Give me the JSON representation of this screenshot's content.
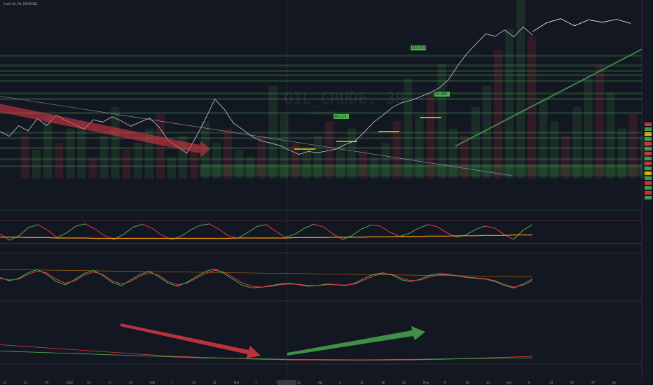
{
  "header": {
    "symbol_line": "Crude Oil, 30, [WTI/USD]"
  },
  "watermark": {
    "symbol": "OIL_CRUDE, 30",
    "name": "Crude Oil"
  },
  "colors": {
    "bg": "#131722",
    "bull": "#26a69a",
    "green": "#4caf50",
    "red": "#e53945",
    "orange": "#ff9800",
    "axis": "#787b86"
  },
  "price_labels": [
    {
      "text": "110.000",
      "value": 110.0
    },
    {
      "text": "99.485",
      "value": 99.485
    },
    {
      "text": "89.113",
      "value": 89.113
    }
  ],
  "time_axis": {
    "labels": [
      "15",
      "22",
      "29",
      "2022",
      "10",
      "17",
      "24",
      "Feb",
      "7",
      "14",
      "21",
      "Mar",
      "7",
      "14",
      "21",
      "Apr",
      "4",
      "11",
      "18",
      "25",
      "May",
      "9",
      "16",
      "23",
      "Jun",
      "6",
      "13",
      "20",
      "27",
      "Jul"
    ],
    "cursor_label": ""
  },
  "chart_data": [
    {
      "type": "line",
      "title": "",
      "series": [
        {
          "values": [
            84.0,
            83.2,
            85.0,
            84.1,
            86.2,
            85.0,
            86.8,
            85.9,
            85.2,
            84.4,
            86.0,
            85.6,
            86.5,
            85.8,
            84.9,
            85.6,
            86.3,
            84.8,
            82.5,
            81.4,
            80.3,
            83.1,
            86.2,
            89.5,
            87.8,
            85.4,
            84.3,
            83.1,
            82.4,
            82.0,
            81.6,
            80.8,
            80.1,
            80.6,
            80.4,
            80.7,
            81.0,
            81.8,
            82.4,
            83.9,
            85.6,
            86.8,
            88.1,
            88.9,
            89.3,
            89.9,
            90.6,
            91.4,
            92.8,
            95.2,
            97.3,
            99.0,
            100.6,
            100.2,
            101.3,
            100.1,
            101.8,
            100.4
          ]
        }
      ],
      "signal_levels": [
        81.0,
        82.3,
        84.0,
        86.4
      ],
      "volume_bars": [
        6,
        4,
        9,
        5,
        7,
        8,
        3,
        6,
        10,
        4,
        5,
        7,
        9,
        3,
        6,
        4,
        8,
        5,
        7,
        4,
        3,
        6,
        13,
        9,
        5,
        4,
        6,
        8,
        5,
        7,
        4,
        3,
        5,
        8,
        14,
        9,
        12,
        16,
        7,
        6,
        10,
        13,
        18,
        21,
        25,
        20,
        11,
        8,
        6,
        10,
        14,
        16,
        12,
        7,
        9,
        6
      ],
      "trend_arrows": [
        {
          "from": [
            0,
            88.0
          ],
          "to": [
            12,
            81.0
          ],
          "color": "red"
        }
      ]
    },
    {
      "type": "line",
      "title": "",
      "series": [
        {
          "values": [
            45,
            28,
            40,
            62,
            70,
            55,
            35,
            48,
            66,
            72,
            58,
            40,
            30,
            44,
            63,
            71,
            60,
            42,
            30,
            38,
            55,
            68,
            72,
            58,
            40,
            33,
            48,
            65,
            70,
            52,
            36,
            44,
            60,
            71,
            64,
            45,
            30,
            40,
            58,
            69,
            66,
            50,
            38,
            46,
            60,
            70,
            64,
            48,
            36,
            42,
            57,
            66,
            61,
            44,
            30,
            55,
            70
          ]
        },
        {
          "values": [
            36,
            36,
            36,
            35,
            35,
            35,
            34,
            34,
            34,
            34,
            33,
            33,
            33,
            33,
            33,
            33,
            33,
            33,
            33,
            33,
            33,
            33,
            33,
            33,
            33,
            34,
            34,
            34,
            34,
            34,
            34,
            35,
            35,
            35,
            35,
            36,
            36,
            36,
            36,
            37,
            37,
            37,
            38,
            38,
            38,
            39,
            39,
            39,
            40,
            40,
            40,
            41,
            41,
            41,
            42,
            42,
            42
          ]
        }
      ],
      "ylim": [
        0,
        100
      ]
    },
    {
      "type": "line",
      "title": "",
      "series": [
        {
          "values": [
            50,
            42,
            48,
            62,
            70,
            58,
            40,
            32,
            45,
            60,
            68,
            55,
            38,
            30,
            44,
            58,
            66,
            52,
            36,
            28,
            38,
            52,
            65,
            72,
            60,
            45,
            30,
            24,
            26,
            30,
            34,
            36,
            32,
            28,
            30,
            34,
            32,
            30,
            36,
            48,
            58,
            62,
            56,
            44,
            40,
            46,
            56,
            60,
            58,
            54,
            50,
            48,
            46,
            40,
            30,
            24,
            34,
            46
          ]
        },
        {
          "values": [
            48,
            44,
            46,
            58,
            66,
            62,
            46,
            36,
            42,
            56,
            64,
            58,
            42,
            34,
            40,
            54,
            62,
            56,
            40,
            32,
            36,
            48,
            60,
            68,
            64,
            50,
            36,
            28,
            26,
            28,
            32,
            34,
            33,
            30,
            30,
            32,
            32,
            31,
            34,
            44,
            54,
            60,
            58,
            48,
            42,
            44,
            52,
            57,
            57,
            55,
            51,
            49,
            47,
            42,
            33,
            26,
            31,
            42
          ]
        }
      ],
      "ylim": [
        0,
        100
      ]
    },
    {
      "type": "line",
      "title": "",
      "series": [
        {
          "values": [
            30,
            28,
            26,
            24,
            22,
            20,
            18,
            16,
            14,
            12,
            10,
            8,
            7,
            6,
            5,
            4,
            3,
            2,
            1.5,
            1,
            0.8,
            0.6,
            0.5,
            0.4,
            0.5,
            0.7,
            1,
            1.5,
            2,
            3,
            4,
            5,
            6,
            7,
            8
          ]
        },
        {
          "values": [
            18,
            17,
            16,
            15,
            14,
            13,
            12,
            11,
            10,
            9,
            8,
            7,
            6,
            5,
            4.5,
            4,
            3.5,
            3,
            2.5,
            2,
            1.8,
            1.6,
            1.5,
            1.4,
            1.5,
            1.7,
            2,
            2.4,
            2.8,
            3.2,
            3.6,
            4,
            4.4,
            4.8,
            5.2
          ]
        }
      ],
      "trend_arrows": [
        {
          "from": [
            0,
            60
          ],
          "to": [
            8,
            10
          ],
          "color": "red"
        },
        {
          "from": [
            10,
            5
          ],
          "to": [
            20,
            45
          ],
          "color": "green"
        }
      ]
    }
  ]
}
